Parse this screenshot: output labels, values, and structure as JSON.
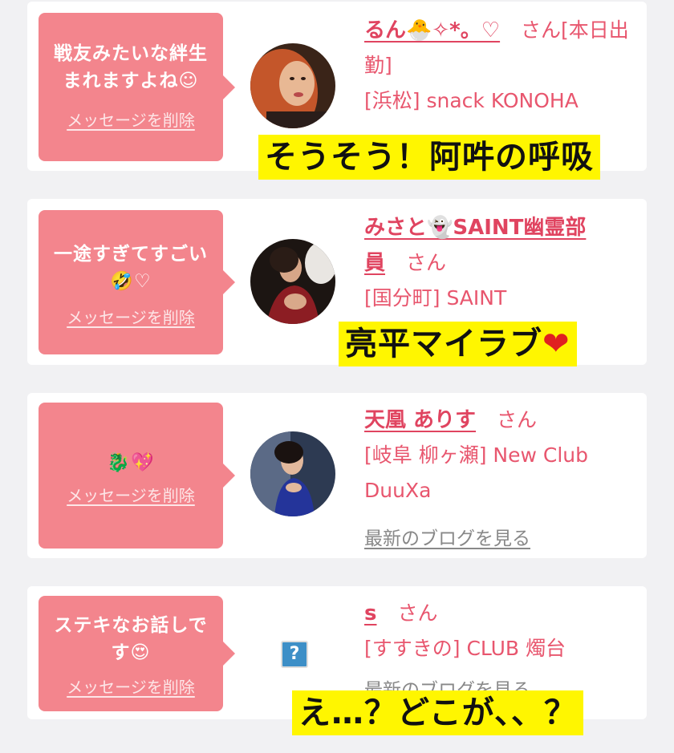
{
  "cards": [
    {
      "message": "戦友みたいな絆生まれますよね☺",
      "delete_label": "メッセージを削除",
      "name": "るん🐣✧*。♡",
      "san_line_rest": "さん[本日出",
      "name_line2": "勤]",
      "location": "[浜松] snack KONOHA",
      "caption": "そうそう！阿吽の呼吸"
    },
    {
      "message_line1": "一途すぎてすごい",
      "message_line2": "🤣♡",
      "delete_label": "メッセージを削除",
      "name_line1": "みさと👻SAINT幽霊部",
      "name_line2": "員",
      "san": "さん",
      "location": "[国分町] SAINT",
      "caption": "亮平マイラブ",
      "caption_heart": "❤"
    },
    {
      "message": "🐉💖",
      "delete_label": "メッセージを削除",
      "name": "天凰 ありす",
      "san": "さん",
      "location_line1": "[岐阜 柳ヶ瀬] New Club",
      "location_line2": "DuuXa",
      "blog_link": "最新のブログを見る"
    },
    {
      "message_line1": "ステキなお話しで",
      "message_line2": "す😍",
      "delete_label": "メッセージを削除",
      "avatar_placeholder": "?",
      "name": "s",
      "san": "さん",
      "location": "[すすきの] CLUB 燭台",
      "blog_link": "最新のブログを見る",
      "caption": "え…？どこが、、？"
    }
  ],
  "colors": {
    "bubble": "#f3858d",
    "name": "#e04460",
    "caption_bg": "#fff600"
  }
}
